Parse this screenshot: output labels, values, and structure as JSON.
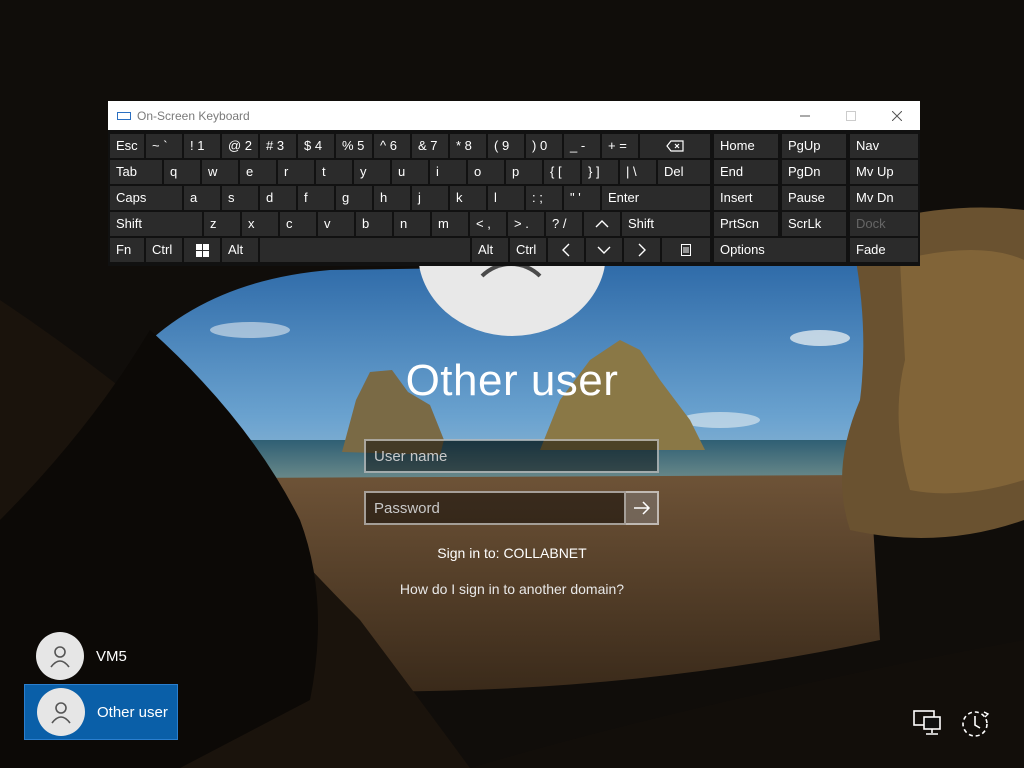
{
  "login": {
    "title": "Other user",
    "username_placeholder": "User name",
    "password_placeholder": "Password",
    "sign_in_to": "Sign in to: COLLABNET",
    "domain_link": "How do I sign in to another domain?"
  },
  "users": [
    {
      "name": "VM5",
      "selected": false
    },
    {
      "name": "Other user",
      "selected": true
    }
  ],
  "corner_icons": [
    "network-icon",
    "ease-of-access-icon"
  ],
  "osk": {
    "title": "On-Screen Keyboard",
    "window_buttons": [
      "minimize",
      "maximize",
      "close"
    ],
    "row1": [
      "Esc",
      "~ `",
      "! 1",
      "@ 2",
      "# 3",
      "$ 4",
      "% 5",
      "^ 6",
      "& 7",
      "* 8",
      "( 9",
      ") 0",
      "_ -",
      "+ ="
    ],
    "row2": [
      "Tab",
      "q",
      "w",
      "e",
      "r",
      "t",
      "y",
      "u",
      "i",
      "o",
      "p",
      "{ [",
      "} ]",
      "| \\",
      "Del"
    ],
    "row3": [
      "Caps",
      "a",
      "s",
      "d",
      "f",
      "g",
      "h",
      "j",
      "k",
      "l",
      ": ;",
      "\" '",
      "Enter"
    ],
    "row4": [
      "Shift",
      "z",
      "x",
      "c",
      "v",
      "b",
      "n",
      "m",
      "< ,",
      "> .",
      "? /",
      "Shift"
    ],
    "row5": [
      "Fn",
      "Ctrl",
      "Alt",
      "Alt",
      "Ctrl"
    ],
    "nav_keys": [
      [
        "Home",
        "PgUp",
        "Nav"
      ],
      [
        "End",
        "PgDn",
        "Mv Up"
      ],
      [
        "Insert",
        "Pause",
        "Mv Dn"
      ],
      [
        "PrtScn",
        "ScrLk",
        "Dock"
      ],
      [
        "Options",
        "Fade"
      ]
    ],
    "colors": {
      "key_bg": "#2b2b2b",
      "board_bg": "#111111",
      "selected_tile": "#0a5fa8"
    }
  }
}
